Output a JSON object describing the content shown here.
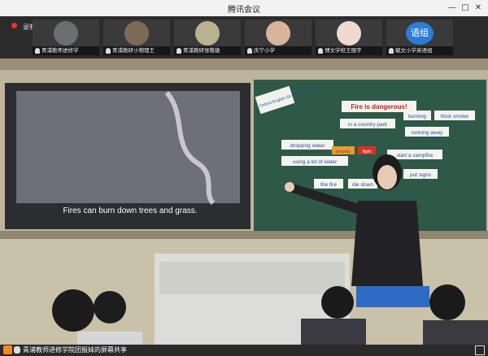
{
  "window": {
    "title": "腾讯会议"
  },
  "status": {
    "recording_label": "录制中"
  },
  "participants": [
    {
      "name": "青浦教师进修学"
    },
    {
      "name": "青浦教研小物理王"
    },
    {
      "name": "青浦教研张敬雄"
    },
    {
      "name": "庆宁小学"
    },
    {
      "name": "博文学校王丽宇"
    },
    {
      "name": "毓文小学英语组",
      "avatar_text": "语组"
    }
  ],
  "video": {
    "screen_caption": "Fires can burn down trees and grass.",
    "board_note": "Oxford English 5A Module 4 Unit 12",
    "board_words": [
      "Fire is dangerous!",
      "in a country park",
      "burning",
      "thick smoke",
      "running away",
      "dropping water",
      "bravely",
      "fight",
      "start a campfire",
      "using a lot of water",
      "the fire",
      "die down",
      "put signs"
    ]
  },
  "footer": {
    "sharer_label": "青浦教师进修学院团报妹的屏幕共享"
  },
  "colors": {
    "record": "#e33",
    "badge": "#f08a1c",
    "avatar_blue": "#2a7ed8"
  }
}
